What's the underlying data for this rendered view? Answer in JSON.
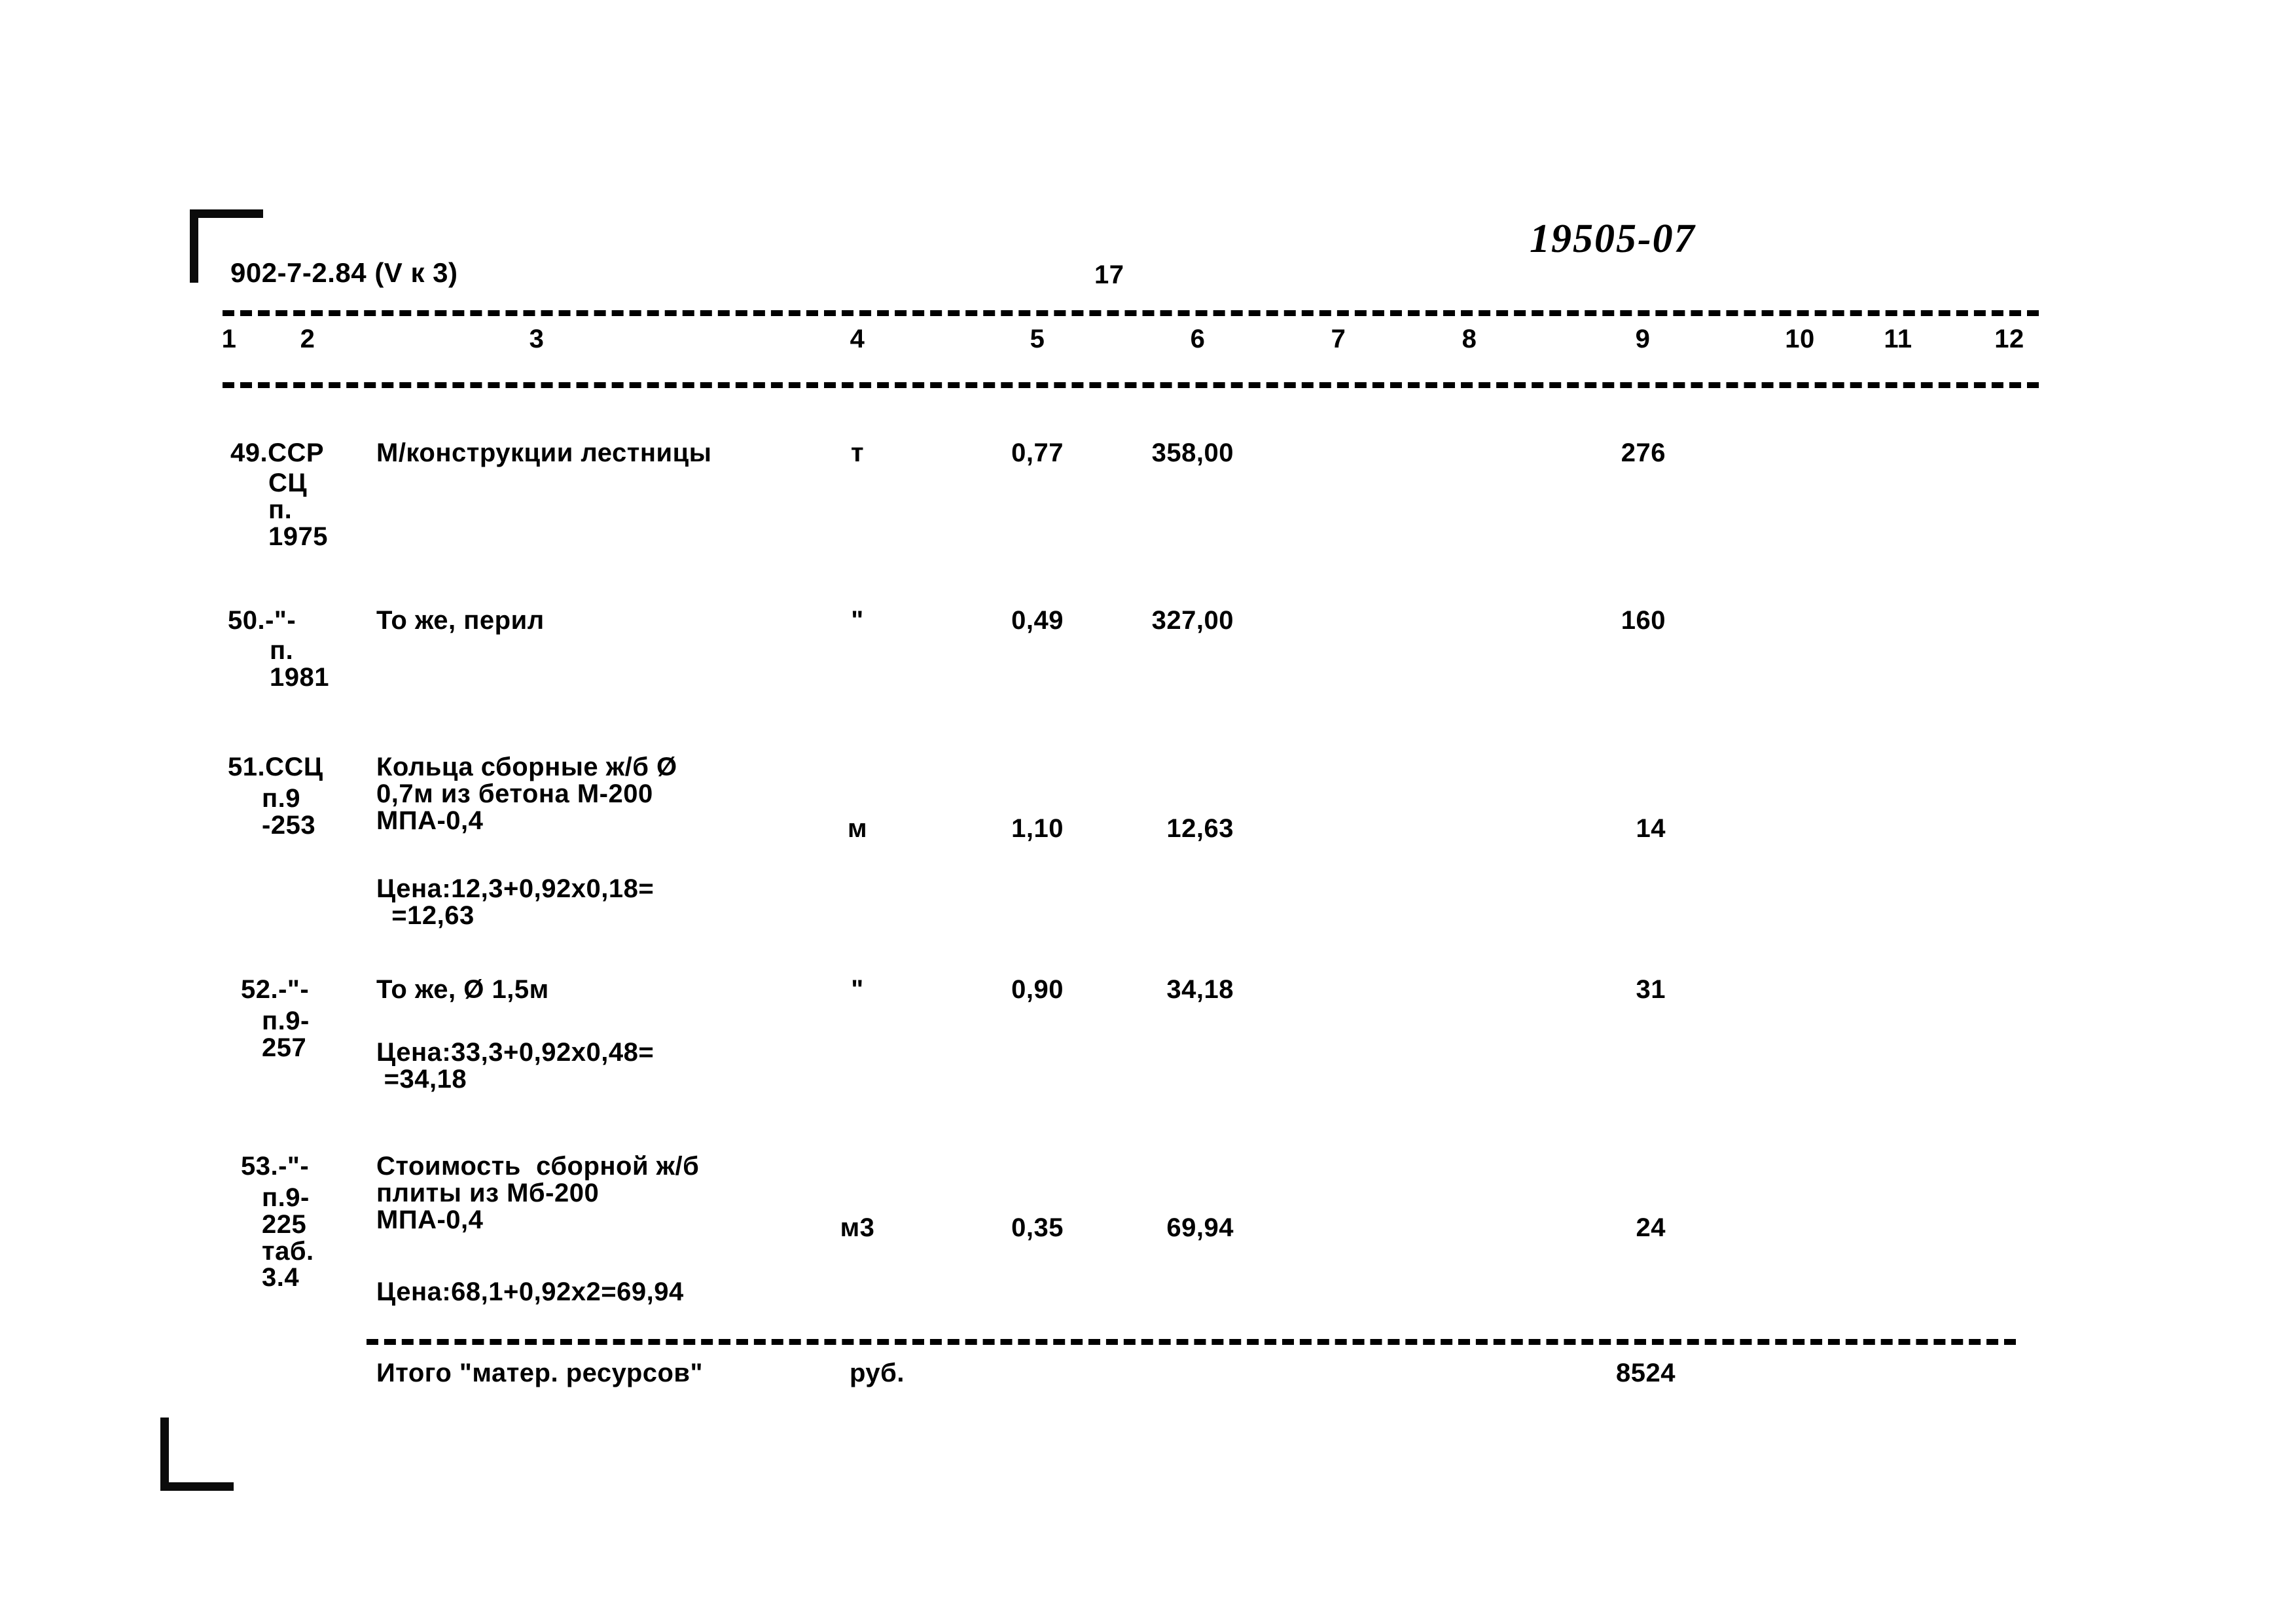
{
  "document": {
    "code": "902-7-2.84 (V к 3)",
    "page_number": "17",
    "handwritten_number": "19505-07"
  },
  "column_headers": [
    "1",
    "2",
    "3",
    "4",
    "5",
    "6",
    "7",
    "8",
    "9",
    "10",
    "11",
    "12"
  ],
  "rows": [
    {
      "num": "49.ССР",
      "code_lines": [
        "СЦ",
        "п.",
        "1975"
      ],
      "desc_lines": [
        "М/конструкции лестницы"
      ],
      "unit": "т",
      "qty": "0,77",
      "price": "358,00",
      "total": "276",
      "note_lines": []
    },
    {
      "num": "50.-\"-",
      "code_lines": [
        "п.",
        "1981"
      ],
      "desc_lines": [
        "То же, перил"
      ],
      "unit": "\"",
      "qty": "0,49",
      "price": "327,00",
      "total": "160",
      "note_lines": []
    },
    {
      "num": "51.ССЦ",
      "code_lines": [
        "п.9",
        "-253"
      ],
      "desc_lines": [
        "Кольца сборные ж/б Ø",
        "0,7м из бетона М-200",
        "МПА-0,4"
      ],
      "unit": "м",
      "qty": "1,10",
      "price": "12,63",
      "total": "14",
      "note_lines": [
        "Цена:12,3+0,92х0,18=",
        "  =12,63"
      ]
    },
    {
      "num": "52.-\"-",
      "code_lines": [
        "п.9-",
        "257"
      ],
      "desc_lines": [
        "То же, Ø 1,5м"
      ],
      "unit": "\"",
      "qty": "0,90",
      "price": "34,18",
      "total": "31",
      "note_lines": [
        "Цена:33,3+0,92х0,48=",
        " =34,18"
      ]
    },
    {
      "num": "53.-\"-",
      "code_lines": [
        "п.9-",
        "225",
        "таб.",
        "3.4"
      ],
      "desc_lines": [
        "Стоимость  сборной ж/б",
        "плиты из Мб-200",
        "МПА-0,4"
      ],
      "unit": "м3",
      "qty": "0,35",
      "price": "69,94",
      "total": "24",
      "note_lines": [
        "Цена:68,1+0,92х2=69,94"
      ]
    }
  ],
  "total_row": {
    "label": "Итого \"матер. ресурсов\"",
    "unit": "руб.",
    "value": "8524"
  },
  "colors": {
    "ink": "#000000",
    "paper": "#ffffff"
  }
}
